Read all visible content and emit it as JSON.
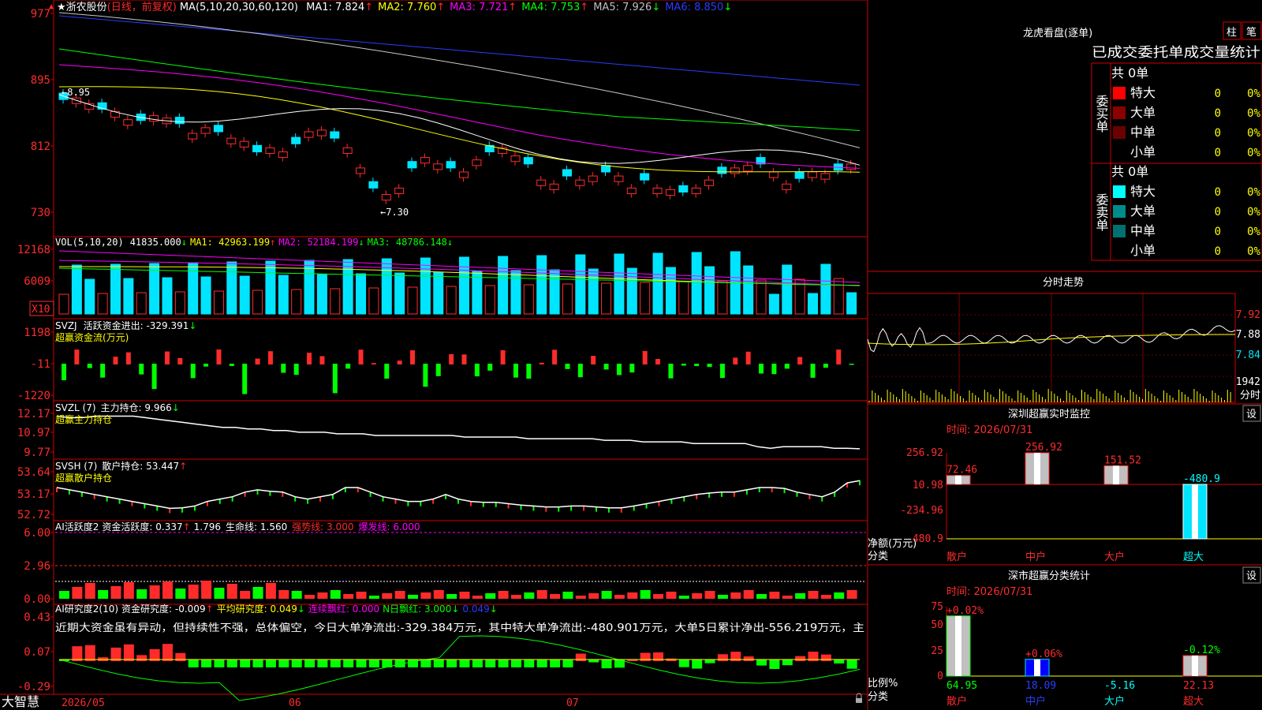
{
  "colors": {
    "up": "#ff2b2b",
    "down": "#00e5ff",
    "green": "#00ff00",
    "grid": "#d00000",
    "yellow": "#ffff00",
    "magenta": "#ff00ff",
    "white": "#ffffff",
    "blue": "#2a3cff",
    "darkred": "#8b0000",
    "teal": "#008080"
  },
  "header": {
    "star": "★",
    "stock_name": "浙农股份",
    "mode": "(日线，前复权)",
    "ma_title": "MA(5,10,20,30,60,120)",
    "ma": [
      {
        "label": "MA1: ",
        "value": "7.824",
        "arrow": "↑",
        "color": "#ffffff"
      },
      {
        "label": "MA2: ",
        "value": "7.760",
        "arrow": "↑",
        "color": "#ffff00"
      },
      {
        "label": "MA3: ",
        "value": "7.721",
        "arrow": "↑",
        "color": "#ff00ff"
      },
      {
        "label": "MA4: ",
        "value": "7.753",
        "arrow": "↑",
        "color": "#00ff00"
      },
      {
        "label": "MA5: ",
        "value": "7.926",
        "arrow": "↓",
        "color": "#c0c0c0"
      },
      {
        "label": "MA6: ",
        "value": "8.850",
        "arrow": "↓",
        "color": "#2a3cff"
      }
    ],
    "top_left_marker": "▲"
  },
  "price_axis": [
    "977",
    "895",
    "812",
    "730"
  ],
  "price_annotations": {
    "high": "8.95",
    "low": "7.30"
  },
  "vol_panel": {
    "title": "VOL(5,10,20)",
    "v1": "41835.000",
    "v1_arrow": "↓",
    "ma1": "MA1: 42963.199",
    "ma1_arrow": "↑",
    "ma2": "MA2: 52184.199",
    "ma2_arrow": "↓",
    "ma3": "MA3: 48786.148",
    "ma3_arrow": "↓",
    "axis": [
      "12168",
      "6009"
    ],
    "unit": "X10"
  },
  "svzj_panel": {
    "title": "SVZJ",
    "desc": "活跃资金进出: ",
    "value": "-329.391",
    "arrow": "↓",
    "line2": "超赢资金流(万元)",
    "axis": [
      "1198",
      "-11",
      "-1220"
    ]
  },
  "svzl_panel": {
    "title": "SVZL (7)",
    "desc": "主力持仓: ",
    "value": "9.966",
    "arrow": "↓",
    "line2": "超赢主力持仓",
    "axis": [
      "12.17",
      "10.97",
      "9.77"
    ]
  },
  "svsh_panel": {
    "title": "SVSH (7)",
    "desc": "散户持仓: ",
    "value": "53.447",
    "arrow": "↑",
    "line2": "超赢散户持仓",
    "axis": [
      "53.64",
      "53.17",
      "52.72"
    ]
  },
  "ai_active": {
    "title": "AI活跃度2",
    "desc": "资金活跃度: ",
    "v1": "0.337",
    "v1_arrow": "↑",
    "v2": "1.796",
    "line": "生命线: 1.560",
    "strong": "强势线: 3.000",
    "burst": "爆发线: 6.000",
    "axis": [
      "6.00",
      "2.96",
      "0.00"
    ]
  },
  "ai_research": {
    "title": "AI研究度2(10)",
    "desc": "资金研究度: ",
    "v1": "-0.009",
    "v1_arrow": "↑",
    "avg": "平均研究度: 0.049",
    "avg_arrow": "↓",
    "cont": "连续飘红: 0.000",
    "n_days": "N日飘红: 3.000",
    "n_arrow": "↓",
    "last": "0.049",
    "last_arrow": "↓",
    "axis": [
      "0.43",
      "0.07",
      "-0.29"
    ],
    "comment": "近期大资金虽有异动，但持续性不强，总体偏空，今日大单净流出:-329.384万元，其中特大单净流出:-480.901万元，大单5日累计净出-556.219万元，主"
  },
  "bottom_bar": {
    "brand": "大智慧",
    "dates": [
      "2026/05",
      "06",
      "07"
    ]
  },
  "dragon_tiger": {
    "title": "龙虎看盘(逐单)",
    "btn_bar": "柱",
    "btn_pen": "笔",
    "header": "已成交委托单成交量统计",
    "buy_label": "委买单",
    "sell_label": "委卖单",
    "buy_total": "共 0单",
    "sell_total": "共 0单",
    "buy_rows": [
      {
        "name": "特大",
        "count": "0",
        "pct": "0%",
        "color": "#ff0000"
      },
      {
        "name": "大单",
        "count": "0",
        "pct": "0%",
        "color": "#8b0000"
      },
      {
        "name": "中单",
        "count": "0",
        "pct": "0%",
        "color": "#6b0000"
      },
      {
        "name": "小单",
        "count": "0",
        "pct": "0%",
        "color": "#000000"
      }
    ],
    "sell_rows": [
      {
        "name": "特大",
        "count": "0",
        "pct": "0%",
        "color": "#00ffff"
      },
      {
        "name": "大单",
        "count": "0",
        "pct": "0%",
        "color": "#008b8b"
      },
      {
        "name": "中单",
        "count": "0",
        "pct": "0%",
        "color": "#007070"
      },
      {
        "name": "小单",
        "count": "0",
        "pct": "0%",
        "color": "#000000"
      }
    ]
  },
  "intraday": {
    "title": "分时走势",
    "axis": [
      "7.92",
      "7.88",
      "7.84"
    ],
    "vol_label": "1942",
    "vol_unit": "分时"
  },
  "sz_monitor": {
    "title": "深圳超赢实时监控",
    "btn": "设",
    "time": "时间: 2026/07/31",
    "axis": [
      "256.92",
      "10.98",
      "-234.96",
      "-480.9"
    ],
    "ylabel": "净额(万元)",
    "xlabel": "分类"
  },
  "sz_stat": {
    "title": "深市超赢分类统计",
    "btn": "设",
    "time": "时间: 2026/07/31",
    "axis": [
      "75",
      "50",
      "25",
      "0"
    ],
    "ylabel": "比例%",
    "xlabel": "分类"
  },
  "chart_data": [
    {
      "type": "bar",
      "title": "深圳超赢实时监控",
      "categories": [
        "散户",
        "中户",
        "大户",
        "超大"
      ],
      "values": [
        72.46,
        256.92,
        151.52,
        -480.9
      ],
      "ylabel": "净额(万元)",
      "xlabel": "分类",
      "ylim": [
        -480.9,
        256.92
      ]
    },
    {
      "type": "bar",
      "title": "深市超赢分类统计",
      "categories": [
        "散户",
        "中户",
        "大户",
        "超大"
      ],
      "series": [
        {
          "values": [
            64.95,
            18.09,
            -5.16,
            22.13
          ]
        },
        {
          "values": [
            0.02,
            0.06,
            0,
            -0.12
          ]
        }
      ],
      "change_labels": [
        "+0.02%",
        "+0.06%",
        "",
        "-0.12%"
      ],
      "ylabel": "比例%",
      "xlabel": "分类",
      "ylim": [
        0,
        75
      ]
    },
    {
      "type": "line",
      "title": "SVZL",
      "ylim": [
        9.77,
        12.17
      ],
      "values": [
        12.0,
        11.9,
        11.9,
        12.0,
        12.0,
        12.0,
        12.0,
        11.9,
        11.8,
        11.7,
        11.6,
        11.5,
        11.4,
        11.3,
        11.3,
        11.2,
        11.2,
        11.1,
        11.1,
        11.0,
        11.0,
        11.0,
        10.9,
        10.9,
        10.9,
        10.8,
        10.8,
        10.8,
        10.8,
        10.8,
        10.8,
        10.8,
        10.7,
        10.7,
        10.7,
        10.7,
        10.7,
        10.6,
        10.6,
        10.6,
        10.6,
        10.6,
        10.6,
        10.5,
        10.5,
        10.5,
        10.4,
        10.4,
        10.4,
        10.4,
        10.3,
        10.3,
        10.3,
        10.3,
        10.3,
        10.1,
        10.0,
        10.1,
        10.1,
        10.1,
        10.1,
        10.0,
        10.0,
        9.97
      ]
    },
    {
      "type": "line",
      "title": "SVSH",
      "ylim": [
        52.72,
        53.64
      ],
      "values": [
        53.3,
        53.25,
        53.2,
        53.15,
        53.1,
        53.05,
        53.0,
        52.95,
        52.9,
        52.85,
        52.86,
        52.9,
        53.0,
        53.05,
        53.1,
        53.2,
        53.25,
        53.22,
        53.2,
        53.1,
        53.05,
        53.1,
        53.15,
        53.3,
        53.3,
        53.2,
        53.1,
        53.05,
        53.0,
        53.0,
        53.05,
        53.15,
        53.05,
        53.0,
        52.98,
        52.98,
        52.95,
        52.92,
        52.9,
        52.88,
        52.88,
        52.9,
        52.9,
        52.88,
        52.86,
        52.86,
        52.9,
        52.95,
        53.0,
        53.05,
        53.1,
        53.15,
        53.18,
        53.2,
        53.2,
        53.25,
        53.3,
        53.3,
        53.28,
        53.2,
        53.15,
        53.1,
        53.2,
        53.4,
        53.45
      ]
    }
  ]
}
